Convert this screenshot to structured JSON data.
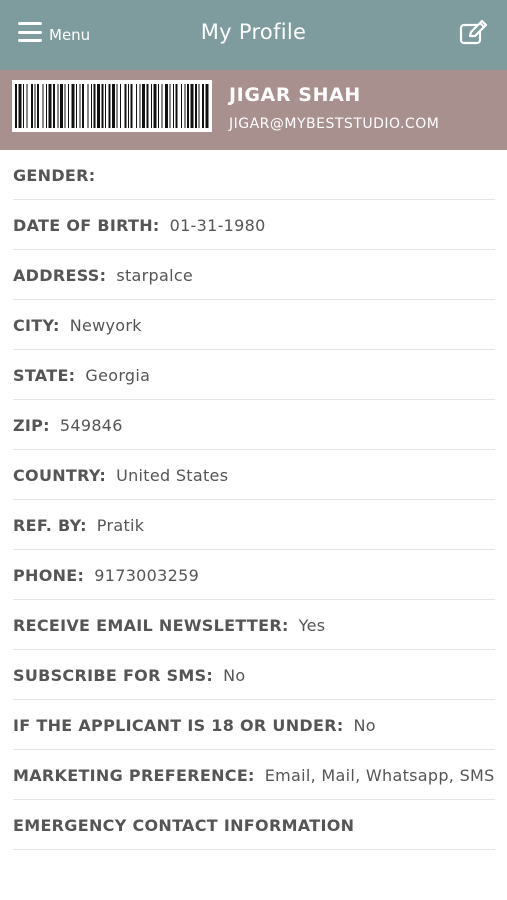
{
  "header": {
    "menu_label": "Menu",
    "title": "My Profile",
    "menu_icon": "hamburger-menu-icon",
    "edit_icon": "edit-icon"
  },
  "profile": {
    "name": "JIGAR SHAH",
    "email": "JIGAR@MYBESTSTUDIO.COM"
  },
  "fields": [
    {
      "label": "GENDER:",
      "value": ""
    },
    {
      "label": "DATE OF BIRTH:",
      "value": "01-31-1980"
    },
    {
      "label": "ADDRESS:",
      "value": "starpalce"
    },
    {
      "label": "CITY:",
      "value": "Newyork"
    },
    {
      "label": "STATE:",
      "value": "Georgia"
    },
    {
      "label": "ZIP:",
      "value": "549846"
    },
    {
      "label": "COUNTRY:",
      "value": "United States"
    },
    {
      "label": "REF. BY:",
      "value": "Pratik"
    },
    {
      "label": "PHONE:",
      "value": "9173003259"
    },
    {
      "label": "RECEIVE EMAIL NEWSLETTER:",
      "value": "Yes"
    },
    {
      "label": "SUBSCRIBE FOR SMS:",
      "value": "No"
    },
    {
      "label": "IF THE APPLICANT IS 18 OR UNDER:",
      "value": "No"
    },
    {
      "label": "MARKETING PREFERENCE:",
      "value": "Email, Mail, Whatsapp, SMS"
    },
    {
      "label": "EMERGENCY CONTACT INFORMATION",
      "value": ""
    }
  ]
}
